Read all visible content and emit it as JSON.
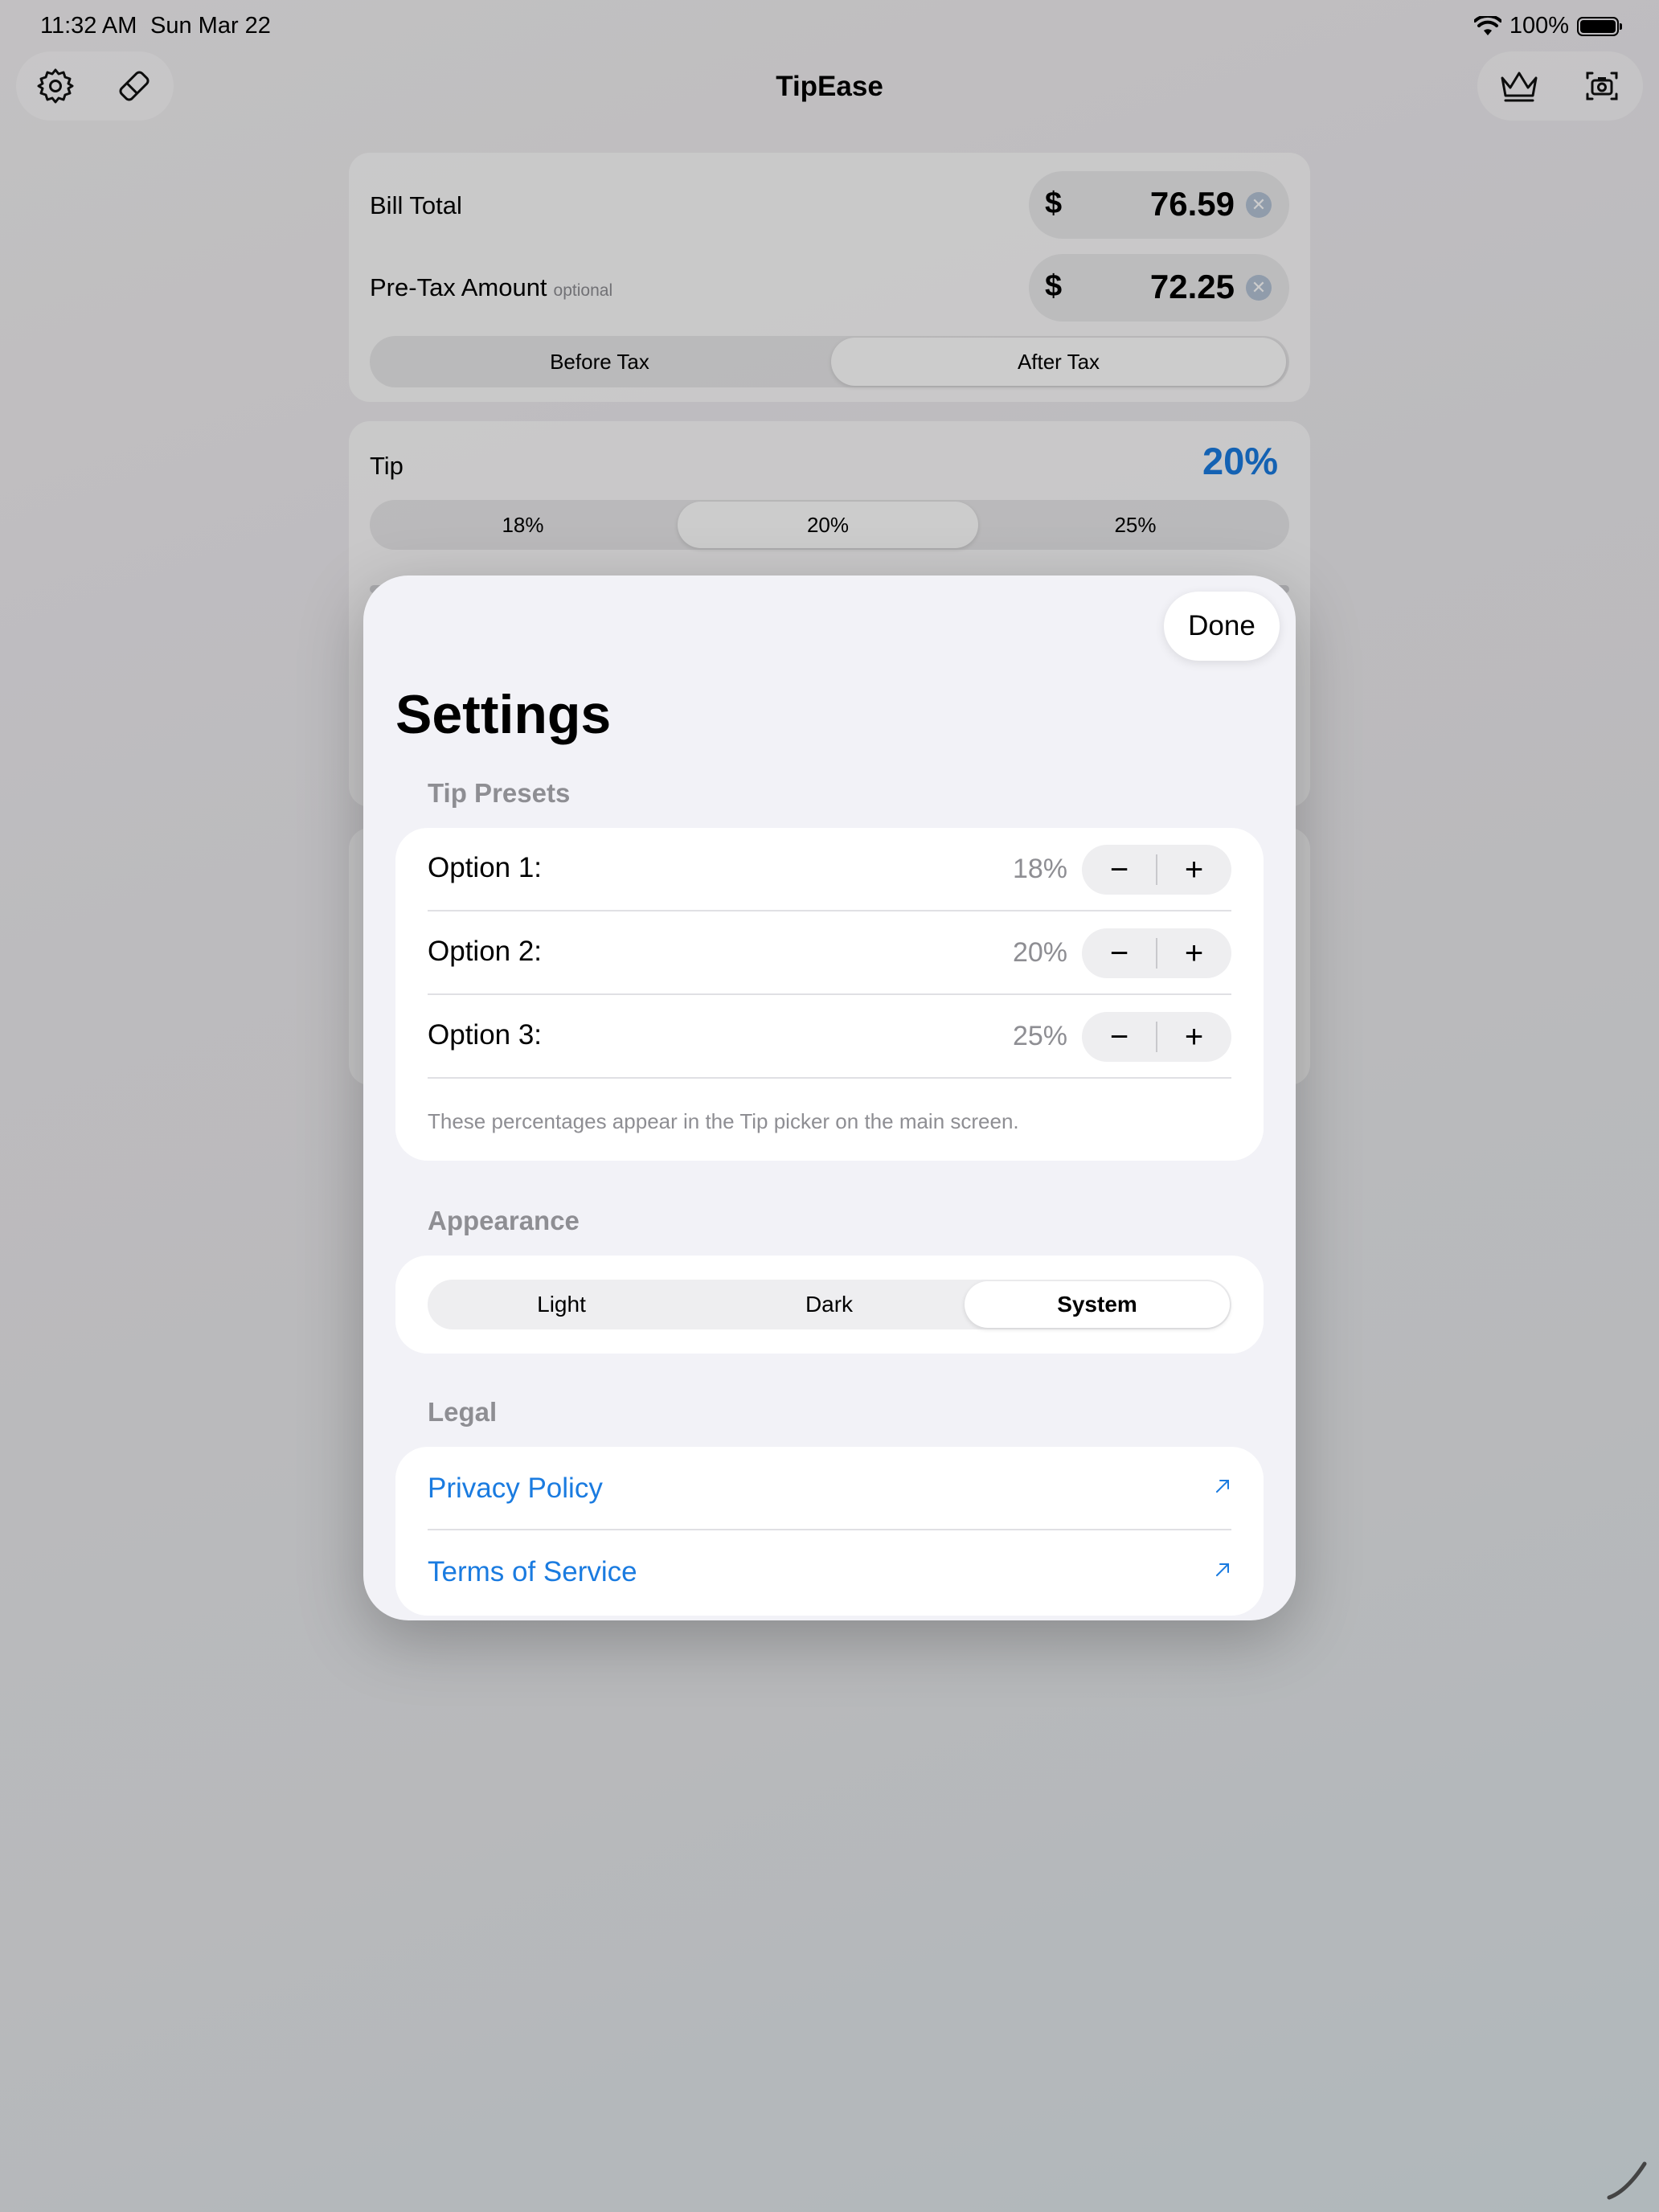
{
  "status_bar": {
    "time": "11:32 AM",
    "date": "Sun Mar 22",
    "battery": "100%"
  },
  "app": {
    "title": "TipEase",
    "toolbar_left": [
      {
        "icon": "gear-icon"
      },
      {
        "icon": "eraser-icon"
      }
    ],
    "toolbar_right": [
      {
        "icon": "crown-icon"
      },
      {
        "icon": "camera-icon"
      }
    ],
    "bill": {
      "bill_total_label": "Bill Total",
      "bill_total_currency": "$",
      "bill_total_value": "76.59",
      "pretax_label": "Pre-Tax Amount",
      "pretax_optional": "optional",
      "pretax_currency": "$",
      "pretax_value": "72.25",
      "tax_mode": {
        "options": [
          "Before Tax",
          "After Tax"
        ],
        "selected": "After Tax"
      }
    },
    "tip": {
      "label": "Tip",
      "value": "20%",
      "presets": [
        "18%",
        "20%",
        "25%"
      ],
      "selected": "20%"
    }
  },
  "settings": {
    "done_label": "Done",
    "title": "Settings",
    "tip_presets": {
      "header": "Tip Presets",
      "options": [
        {
          "label": "Option 1:",
          "value": "18%"
        },
        {
          "label": "Option 2:",
          "value": "20%"
        },
        {
          "label": "Option 3:",
          "value": "25%"
        }
      ],
      "minus_symbol": "−",
      "plus_symbol": "+",
      "footnote": "These percentages appear in the Tip picker on the main screen."
    },
    "appearance": {
      "header": "Appearance",
      "options": [
        "Light",
        "Dark",
        "System"
      ],
      "selected": "System"
    },
    "legal": {
      "header": "Legal",
      "links": [
        {
          "label": "Privacy Policy"
        },
        {
          "label": "Terms of Service"
        }
      ]
    }
  },
  "colors": {
    "accent": "#1a7be0",
    "sheet_bg": "#f2f2f7",
    "secondary_text": "#8e8e93"
  }
}
